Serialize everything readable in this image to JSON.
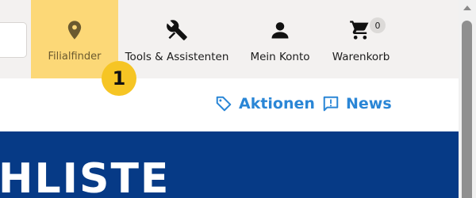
{
  "header": {
    "nav": {
      "filialfinder": {
        "label": "Filialfinder",
        "icon": "map-pin-icon"
      },
      "tools": {
        "label": "Tools & Assistenten",
        "icon": "tools-icon"
      },
      "konto": {
        "label": "Mein Konto",
        "icon": "user-icon"
      },
      "warenkorb": {
        "label": "Warenkorb",
        "icon": "cart-icon",
        "count": "0"
      }
    },
    "step_marker": "1"
  },
  "links": {
    "aktionen": {
      "label": "Aktionen",
      "icon": "tag-icon"
    },
    "news": {
      "label": "News",
      "icon": "news-icon"
    }
  },
  "banner": {
    "text": "HLISTE"
  },
  "colors": {
    "highlight": "#fcd877",
    "marker": "#f6c524",
    "link": "#2a86d6",
    "banner": "#063a86"
  }
}
